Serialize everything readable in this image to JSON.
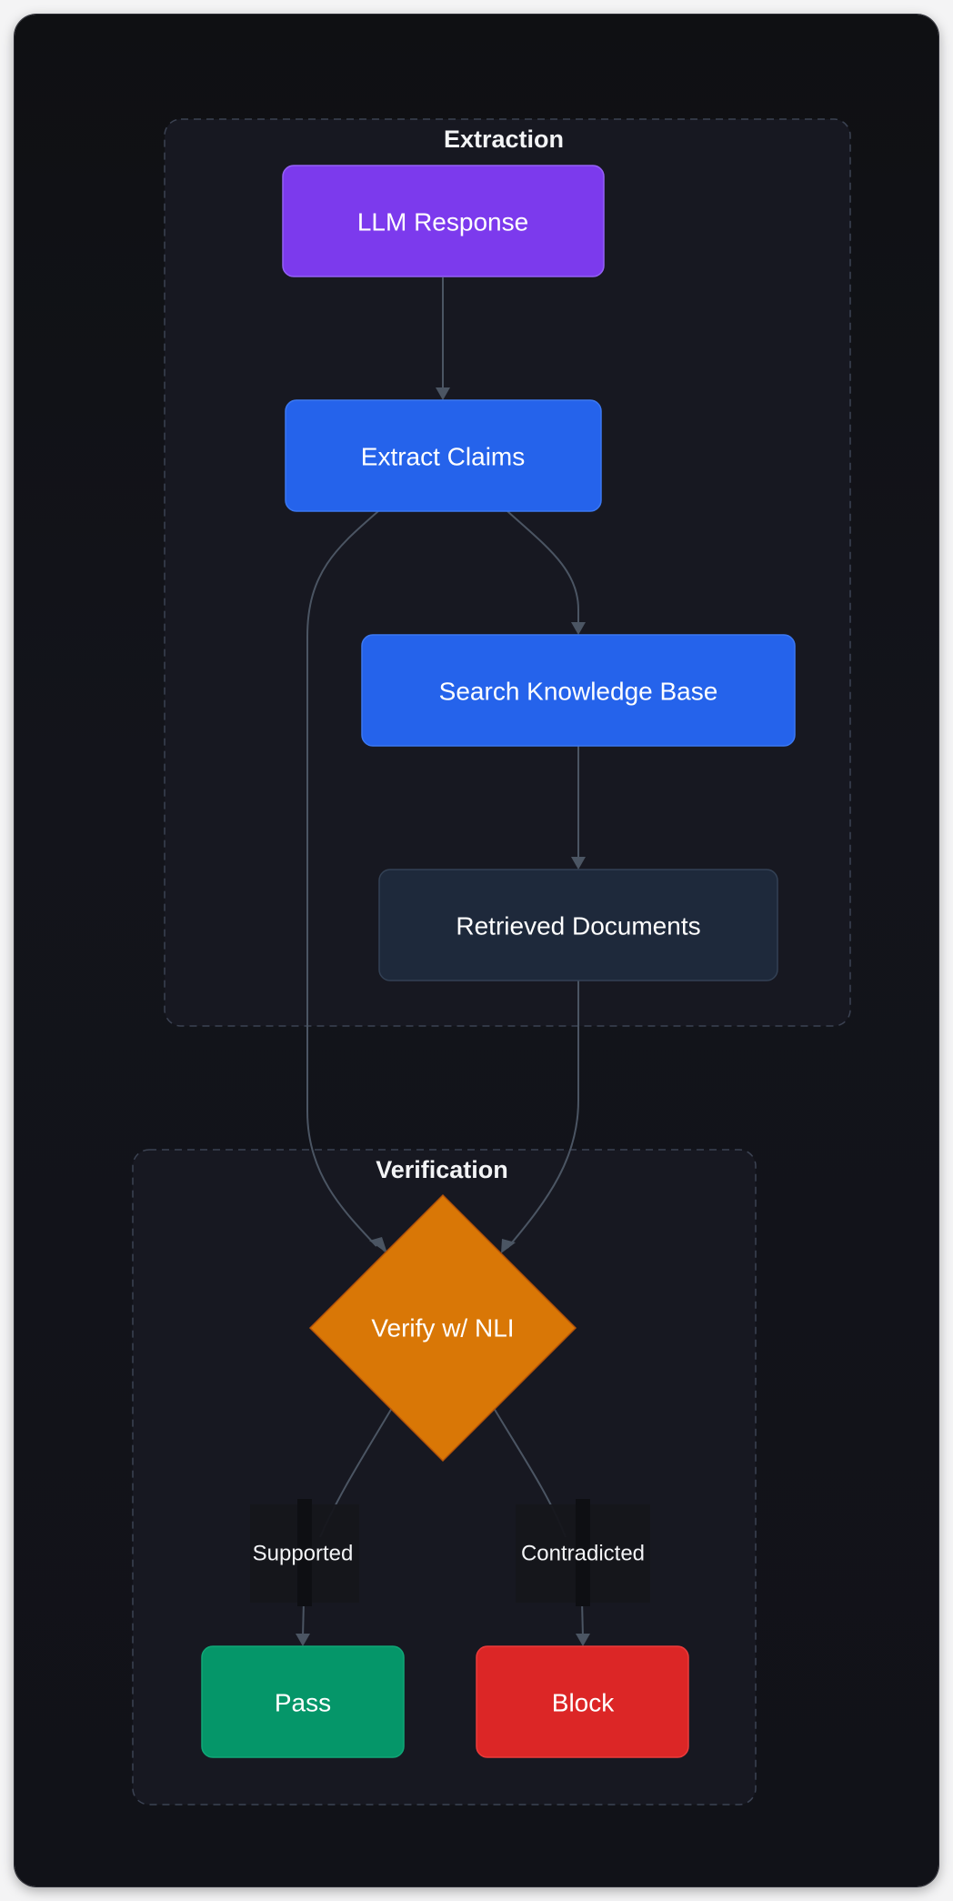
{
  "groups": {
    "extraction": {
      "title": "Extraction"
    },
    "verification": {
      "title": "Verification"
    }
  },
  "nodes": {
    "llm_response": {
      "label": "LLM Response",
      "color": "#7c3aed"
    },
    "extract_claims": {
      "label": "Extract Claims",
      "color": "#2563eb"
    },
    "search_kb": {
      "label": "Search Knowledge Base",
      "color": "#2563eb"
    },
    "retrieved_docs": {
      "label": "Retrieved Documents",
      "color": "#1e293b"
    },
    "verify_nli": {
      "label": "Verify w/ NLI",
      "color": "#d97706"
    },
    "pass": {
      "label": "Pass",
      "color": "#059669"
    },
    "block": {
      "label": "Block",
      "color": "#dc2626"
    }
  },
  "edges": {
    "supported": {
      "label": "Supported"
    },
    "contradicted": {
      "label": "Contradicted"
    }
  }
}
